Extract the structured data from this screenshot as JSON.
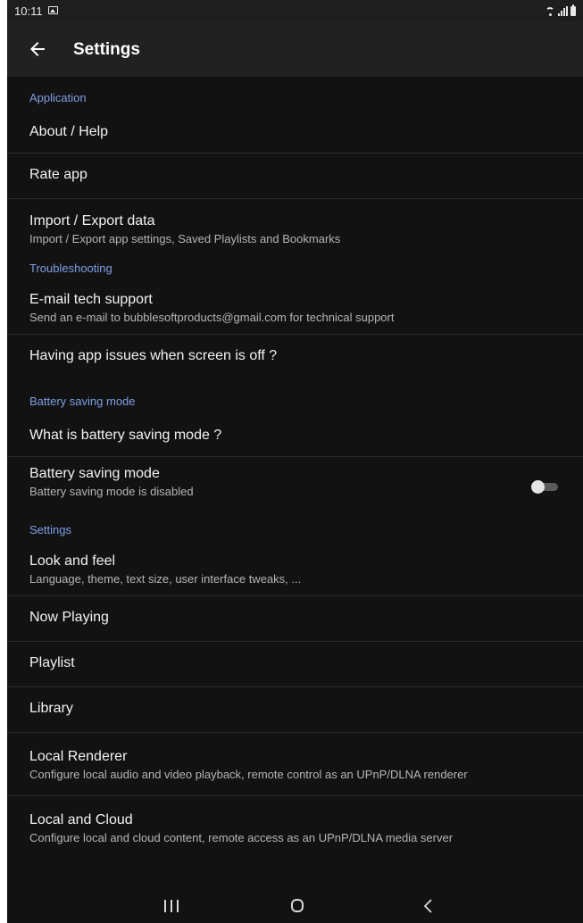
{
  "status_bar": {
    "time": "10:11"
  },
  "app_bar": {
    "title": "Settings"
  },
  "sections": {
    "application": {
      "header": "Application",
      "about_help": "About / Help",
      "rate_app": "Rate app",
      "import_export_title": "Import / Export data",
      "import_export_subtitle": "Import / Export app settings, Saved Playlists and Bookmarks"
    },
    "troubleshooting": {
      "header": "Troubleshooting",
      "email_title": "E-mail tech support",
      "email_subtitle": "Send an e-mail to bubblesoftproducts@gmail.com for technical support",
      "screen_off": "Having app issues when screen is off ?"
    },
    "battery": {
      "header": "Battery saving mode",
      "what_is": "What is battery saving mode ?",
      "mode_title": "Battery saving mode",
      "mode_subtitle": "Battery saving mode is disabled",
      "enabled": false
    },
    "settings": {
      "header": "Settings",
      "look_title": "Look and feel",
      "look_subtitle": "Language, theme, text size, user interface tweaks, ...",
      "now_playing": "Now Playing",
      "playlist": "Playlist",
      "library": "Library",
      "renderer_title": "Local Renderer",
      "renderer_subtitle": "Configure local audio and video playback, remote control as an UPnP/DLNA renderer",
      "cloud_title": "Local and Cloud",
      "cloud_subtitle": "Configure local and cloud content, remote access as an UPnP/DLNA media server"
    }
  },
  "colors": {
    "background": "#121212",
    "app_bar": "#212121",
    "section_header": "#7f9fe6",
    "divider": "#2c2c2c"
  },
  "icons": {
    "back": "arrow-left-icon",
    "toggle": "switch-off",
    "nav_recent": "recent-apps-icon",
    "nav_home": "home-icon",
    "nav_back": "chevron-left-icon"
  }
}
